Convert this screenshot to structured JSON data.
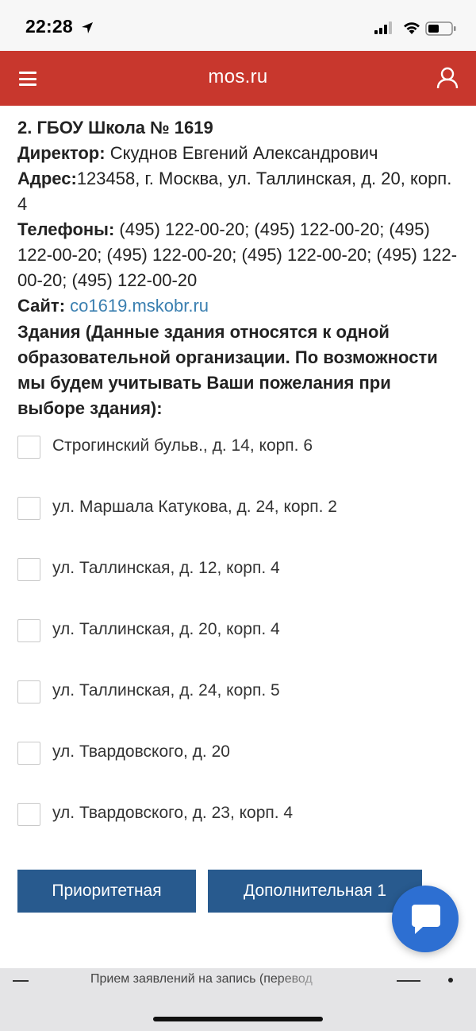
{
  "status_bar": {
    "time": "22:28"
  },
  "header": {
    "title": "mos.ru",
    "accent_color": "#c8372d",
    "icons": [
      "hamburger-menu-icon",
      "user-icon"
    ]
  },
  "school": {
    "title": "2. ГБОУ Школа № 1619",
    "director_label": "Директор:",
    "director_value": " Скуднов Евгений Александрович",
    "address_label": "Адрес:",
    "address_value": "123458, г. Москва, ул. Таллинская, д. 20, корп. 4",
    "phones_label": "Телефоны:",
    "phones_value": " (495) 122-00-20; (495) 122-00-20; (495) 122-00-20; (495) 122-00-20; (495) 122-00-20; (495) 122-00-20; (495) 122-00-20",
    "site_label": "Сайт:",
    "site_value": "co1619.mskobr.ru"
  },
  "buildings": {
    "heading": "Здания (Данные здания относятся к одной образовательной организации. По возможности мы будем учитывать Ваши пожелания при выборе здания):",
    "items": [
      {
        "label": "Строгинский бульв., д. 14, корп. 6",
        "checked": false
      },
      {
        "label": "ул. Маршала Катукова, д. 24, корп. 2",
        "checked": false
      },
      {
        "label": "ул. Таллинская, д. 12, корп. 4",
        "checked": false
      },
      {
        "label": "ул. Таллинская, д. 20, корп. 4",
        "checked": false
      },
      {
        "label": "ул. Таллинская, д. 24, корп. 5",
        "checked": false
      },
      {
        "label": "ул. Твардовского, д. 20",
        "checked": false
      },
      {
        "label": "ул. Твардовского, д. 23, корп. 4",
        "checked": false
      }
    ]
  },
  "actions": {
    "priority_label": "Приоритетная",
    "additional_label": "Дополнительная 1",
    "button_color": "#285a8e"
  },
  "chat": {
    "icon": "chat-bubble-icon",
    "color": "#2d6fd2"
  },
  "bottom_bar": {
    "text": "Прием заявлений на запись (перевод"
  }
}
